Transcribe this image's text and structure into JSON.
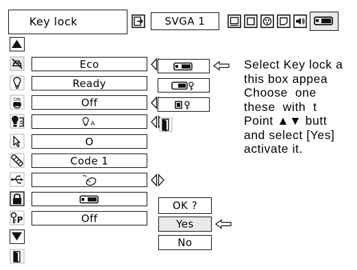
{
  "top_bar": {
    "title": "Key lock",
    "input_mode": "SVGA 1"
  },
  "menu_rows": [
    {
      "value": "Eco",
      "icon": "lamp-mode-icon",
      "has_arrows": true
    },
    {
      "value": "Ready",
      "icon": "bulb-icon",
      "has_arrows": false
    },
    {
      "value": "Off",
      "icon": "power-management-icon",
      "has_arrows": true
    },
    {
      "value": "",
      "icon": "lamp-counter-icon",
      "has_arrows": true
    },
    {
      "value": "O",
      "icon": "pointer-icon",
      "has_arrows": false
    },
    {
      "value": "Code 1",
      "icon": "remote-control-icon",
      "has_arrows": false
    },
    {
      "value": "",
      "icon": "usb-icon",
      "has_arrows": true
    },
    {
      "value": "",
      "icon": "key-lock-icon",
      "has_arrows": false
    },
    {
      "value": "Off",
      "icon": "pin-code-lock-icon",
      "has_arrows": false
    }
  ],
  "confirm": {
    "question": "OK ?",
    "yes": "Yes",
    "no": "No"
  },
  "description": {
    "lines": [
      "Select Key lock a",
      "this box appea",
      "Choose  one",
      "these  with  t",
      "Point ▲▼ butt",
      "and select [Yes]",
      "activate it."
    ]
  },
  "accent_colors": {
    "highlight_bg": "#e9e9e9",
    "border": "#111111"
  }
}
